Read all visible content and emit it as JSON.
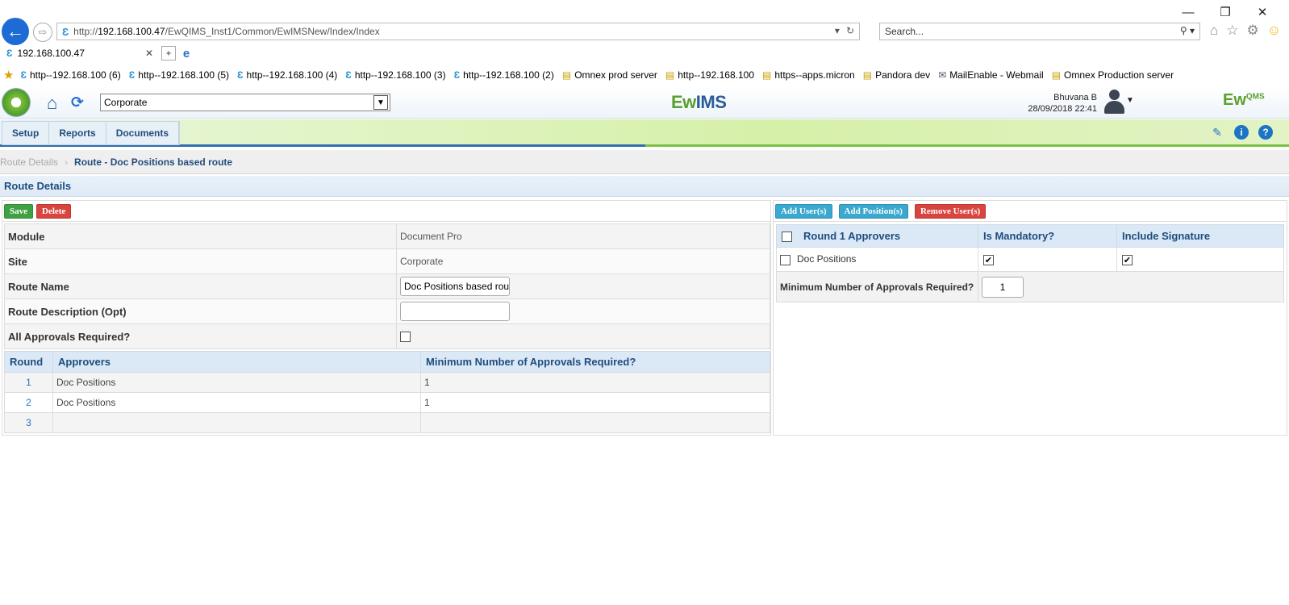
{
  "browser": {
    "window_controls": [
      "—",
      "❐",
      "✕"
    ],
    "address": {
      "prefix": "http://",
      "host": "192.168.100.47",
      "path": "/EwQIMS_Inst1/Common/EwIMSNew/Index/Index"
    },
    "search_placeholder": "Search...",
    "tab_title": "192.168.100.47",
    "favorites": [
      {
        "label": "http--192.168.100 (6)",
        "icon": "ewims-favicon"
      },
      {
        "label": "http--192.168.100 (5)",
        "icon": "ewims-favicon"
      },
      {
        "label": "http--192.168.100 (4)",
        "icon": "ewims-favicon"
      },
      {
        "label": "http--192.168.100 (3)",
        "icon": "ewims-favicon"
      },
      {
        "label": "http--192.168.100 (2)",
        "icon": "ewims-favicon"
      },
      {
        "label": "Omnex prod server",
        "icon": "page-icon"
      },
      {
        "label": "http--192.168.100",
        "icon": "page-icon"
      },
      {
        "label": "https--apps.micron",
        "icon": "page-icon"
      },
      {
        "label": "Pandora dev",
        "icon": "page-icon"
      },
      {
        "label": "MailEnable - Webmail",
        "icon": "mail-icon"
      },
      {
        "label": "Omnex Production server",
        "icon": "page-icon"
      }
    ]
  },
  "header": {
    "site_selected": "Corporate",
    "center_logo": {
      "part1": "Ew",
      "part2": "IMS"
    },
    "right_logo": {
      "part1": "Ew",
      "part2": "QMS"
    },
    "user_name": "Bhuvana B",
    "datetime": "28/09/2018 22:41"
  },
  "menu": {
    "items": [
      "Setup",
      "Reports",
      "Documents"
    ]
  },
  "breadcrumb": {
    "first": "Route Details",
    "current": "Route - Doc Positions based route"
  },
  "section_title": "Route Details",
  "left": {
    "buttons": {
      "save": "Save",
      "delete": "Delete"
    },
    "fields": {
      "module_label": "Module",
      "module_value": "Document Pro",
      "site_label": "Site",
      "site_value": "Corporate",
      "route_name_label": "Route Name",
      "route_name_value": "Doc Positions based rou",
      "route_desc_label": "Route Description (Opt)",
      "route_desc_value": "",
      "all_approvals_label": "All Approvals Required?",
      "all_approvals_checked": false
    },
    "rounds_table": {
      "headers": [
        "Round",
        "Approvers",
        "Minimum Number of Approvals Required?"
      ],
      "rows": [
        {
          "round": "1",
          "approvers": "Doc Positions",
          "min": "1"
        },
        {
          "round": "2",
          "approvers": "Doc Positions",
          "min": "1"
        },
        {
          "round": "3",
          "approvers": "",
          "min": ""
        }
      ]
    }
  },
  "right": {
    "buttons": {
      "add_users": "Add User(s)",
      "add_positions": "Add Position(s)",
      "remove_users": "Remove User(s)"
    },
    "approvers_table": {
      "headers": [
        "Round 1 Approvers",
        "Is Mandatory?",
        "Include Signature"
      ],
      "rows": [
        {
          "name": "Doc Positions",
          "mandatory": true,
          "signature": true
        }
      ],
      "min_label": "Minimum Number of Approvals Required?",
      "min_value": "1"
    }
  },
  "colors": {
    "accent_blue": "#1e4d7f",
    "save_green": "#3fa142",
    "delete_red": "#d9443f",
    "add_blue": "#3aa8cf"
  }
}
